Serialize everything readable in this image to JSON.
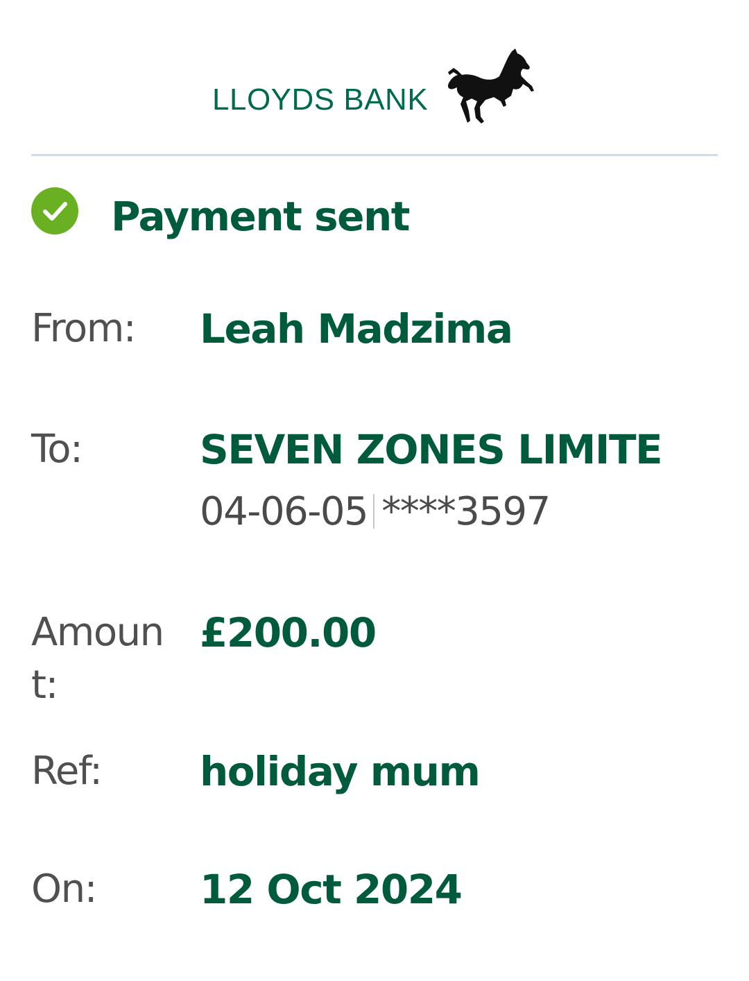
{
  "brand": {
    "name": "LLOYDS BANK",
    "logo_icon": "black-horse-icon",
    "brand_color": "#006a4d"
  },
  "status": {
    "icon": "check-circle-icon",
    "icon_color": "#6ab023",
    "title": "Payment sent"
  },
  "details": {
    "from": {
      "label": "From:",
      "value": "Leah Madzima"
    },
    "to": {
      "label": "To:",
      "value": "SEVEN ZONES LIMITE",
      "sort_code": "04-06-05",
      "account": "****3597"
    },
    "amount": {
      "label": "Amount:",
      "value": "£200.00"
    },
    "ref": {
      "label": "Ref:",
      "value": "holiday mum"
    },
    "on": {
      "label": "On:",
      "value": "12 Oct 2024"
    }
  }
}
